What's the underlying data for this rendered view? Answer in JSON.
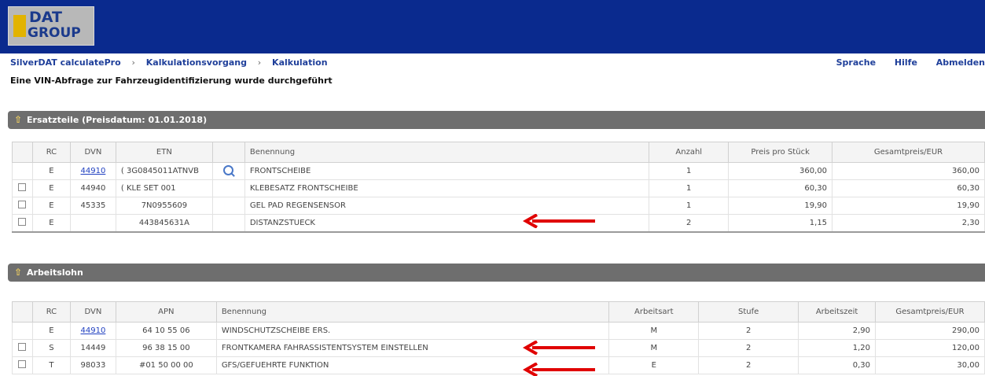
{
  "header": {
    "logo_line1": "DAT",
    "logo_line2": "GROUP"
  },
  "breadcrumb": {
    "items": [
      "SilverDAT calculatePro",
      "Kalkulationsvorgang",
      "Kalkulation"
    ],
    "separator": "›"
  },
  "toplinks": [
    "Sprache",
    "Hilfe",
    "Abmelden"
  ],
  "message": "Eine VIN-Abfrage zur Fahrzeugidentifizierung wurde durchgeführt",
  "parts": {
    "section_title": "Ersatzteile (Preisdatum: 01.01.2018)",
    "columns": [
      "",
      "RC",
      "DVN",
      "ETN",
      "",
      "Benennung",
      "Anzahl",
      "Preis pro Stück",
      "Gesamtpreis/EUR"
    ],
    "rows": [
      {
        "rc": "E",
        "dvn": "44910",
        "etn": "( 3G0845011ATNVB",
        "name": "FRONTSCHEIBE",
        "qty": "1",
        "unit": "360,00",
        "total": "360,00"
      },
      {
        "rc": "E",
        "dvn": "44940",
        "etn": "( KLE SET 001",
        "name": "KLEBESATZ FRONTSCHEIBE",
        "qty": "1",
        "unit": "60,30",
        "total": "60,30"
      },
      {
        "rc": "E",
        "dvn": "45335",
        "etn": "7N0955609",
        "name": "GEL PAD REGENSENSOR",
        "qty": "1",
        "unit": "19,90",
        "total": "19,90"
      },
      {
        "rc": "E",
        "dvn": "",
        "etn": "443845631A",
        "name": "DISTANZSTUECK",
        "qty": "2",
        "unit": "1,15",
        "total": "2,30"
      }
    ]
  },
  "labor": {
    "section_title": "Arbeitslohn",
    "columns": [
      "",
      "RC",
      "DVN",
      "APN",
      "Benennung",
      "Arbeitsart",
      "Stufe",
      "Arbeitszeit",
      "Gesamtpreis/EUR"
    ],
    "rows": [
      {
        "rc": "E",
        "dvn": "44910",
        "apn": "64 10 55 06",
        "name": "WINDSCHUTZSCHEIBE ERS.",
        "art": "M",
        "stufe": "2",
        "zeit": "2,90",
        "total": "290,00"
      },
      {
        "rc": "S",
        "dvn": "14449",
        "apn": "96 38 15 00",
        "name": "FRONTKAMERA FAHRASSISTENTSYSTEM EINSTELLEN",
        "art": "M",
        "stufe": "2",
        "zeit": "1,20",
        "total": "120,00"
      },
      {
        "rc": "T",
        "dvn": "98033",
        "apn": "#01 50 00 00",
        "name": "GFS/GEFUEHRTE FUNKTION",
        "art": "E",
        "stufe": "2",
        "zeit": "0,30",
        "total": "30,00"
      }
    ]
  },
  "colors": {
    "header_bg": "#0a2a8e",
    "section_bar": "#6e6e6e",
    "annotation_arrow": "#e00000",
    "link": "#1f3fc0"
  },
  "icons": [
    "magnifier-icon",
    "expand-arrows-icon",
    "red-annotation-arrow"
  ]
}
